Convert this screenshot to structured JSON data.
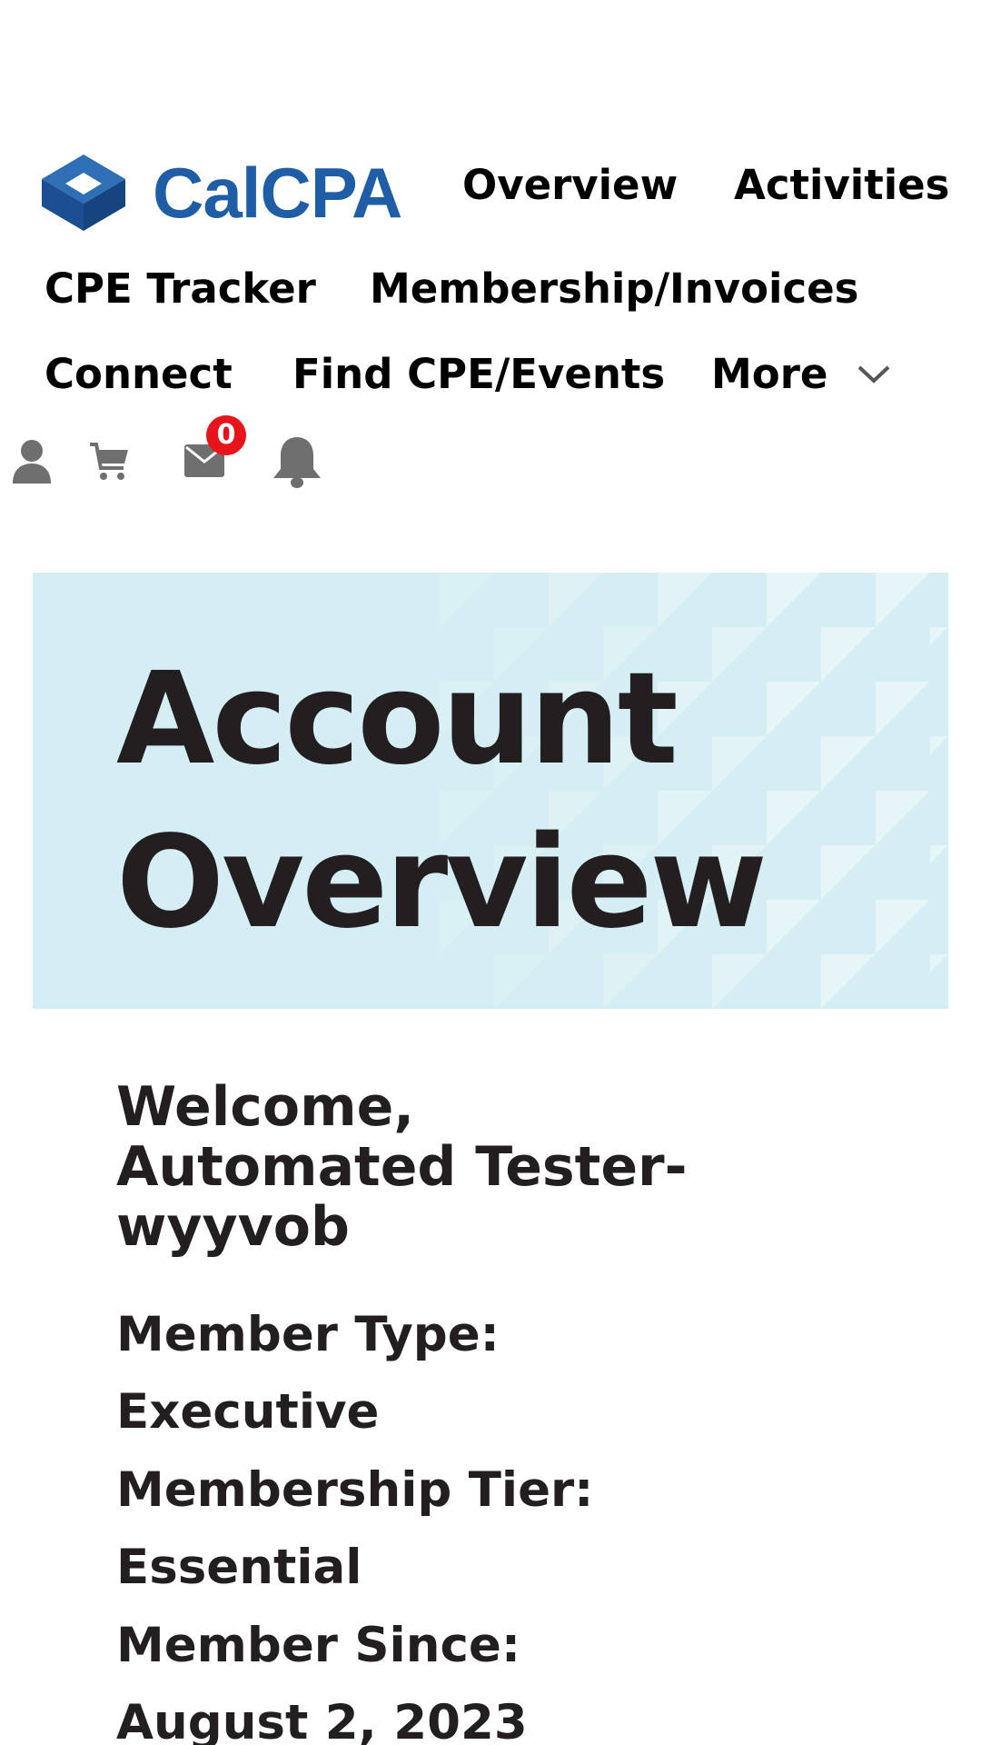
{
  "brand": {
    "name": "CalCPA",
    "color": "#1f5da6"
  },
  "nav": {
    "items": [
      {
        "label": "Overview"
      },
      {
        "label": "Activities"
      },
      {
        "label": "CPE Tracker"
      },
      {
        "label": "Membership/Invoices"
      },
      {
        "label": "Connect"
      },
      {
        "label": "Find CPE/Events"
      }
    ],
    "more_label": "More"
  },
  "toolbar": {
    "icons": [
      "user-icon",
      "cart-icon",
      "mail-icon",
      "bell-icon"
    ],
    "mail_count": "0",
    "badge_color": "#e8141c"
  },
  "hero": {
    "title_line1": "Account",
    "title_line2": "Overview",
    "background": "#d4eef3"
  },
  "account": {
    "welcome": "Welcome, Automated Tester-wyyvob",
    "member_type_label": "Member Type:",
    "member_type_value": "Executive",
    "tier_label": "Membership Tier:",
    "tier_value": "Essential",
    "since_label": "Member Since:",
    "since_value": "August 2, 2023"
  }
}
